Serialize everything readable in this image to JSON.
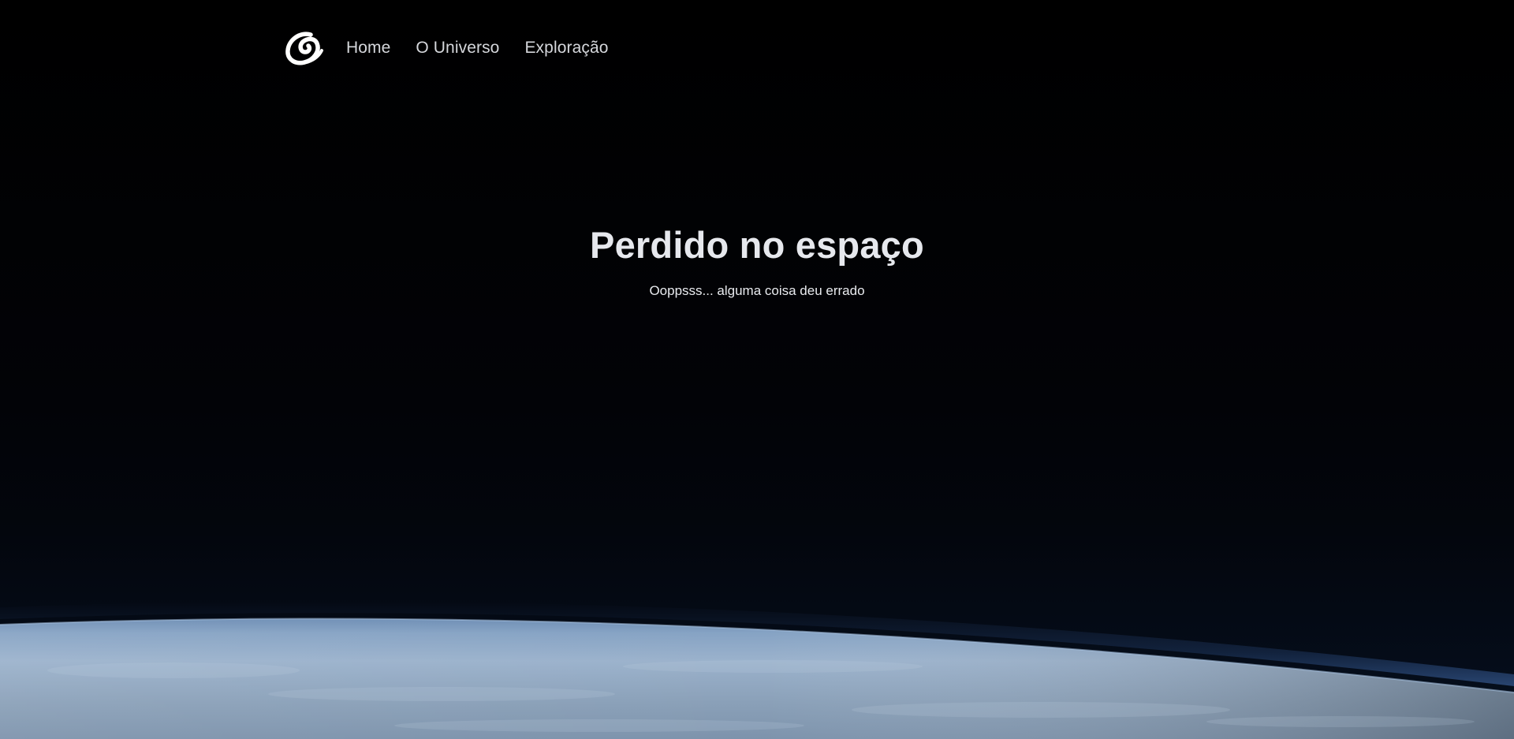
{
  "nav": {
    "logo_icon": "galaxy-swirl-icon",
    "links": [
      {
        "label": "Home"
      },
      {
        "label": "O Universo"
      },
      {
        "label": "Exploração"
      }
    ]
  },
  "hero": {
    "title": "Perdido no espaço",
    "subtitle": "Ooppsss... alguma coisa deu errado"
  },
  "colors": {
    "background": "#010103",
    "earth_atmosphere": "#6f8fb3",
    "text": "#e6e8ed"
  }
}
